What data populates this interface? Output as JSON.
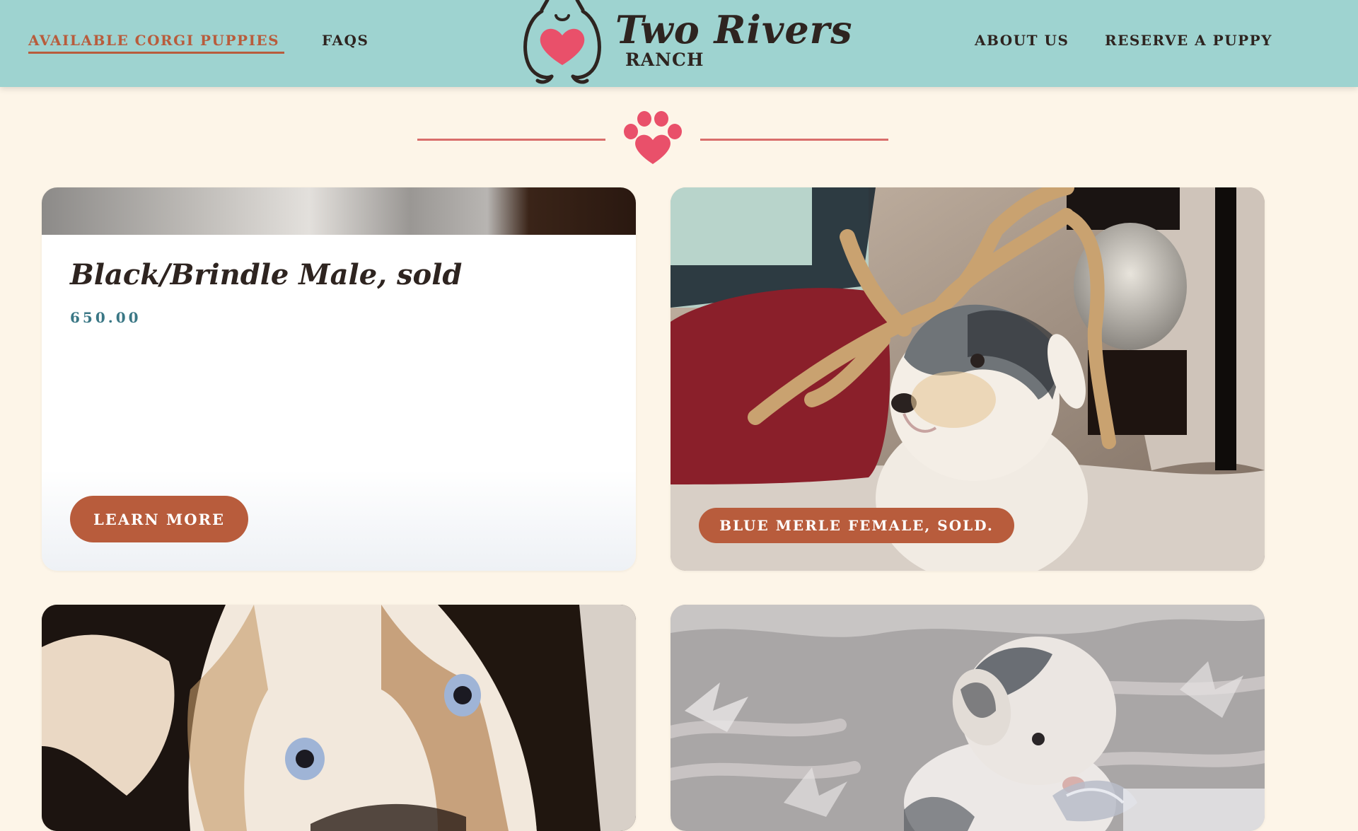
{
  "header": {
    "nav_left": [
      "AVAILABLE CORGI PUPPIES",
      "FAQS"
    ],
    "nav_right": [
      "ABOUT US",
      "RESERVE A PUPPY"
    ],
    "logo_title": "Two Rivers",
    "logo_subtitle": "RANCH"
  },
  "colors": {
    "header_bg": "#9ed3d0",
    "page_bg": "#fdf5e8",
    "accent": "#b85c3c",
    "paw": "#e9506a",
    "price": "#3a7785",
    "text_dark": "#2e2420"
  },
  "icons": [
    "corgi-heart-logo-icon",
    "paw-heart-icon"
  ],
  "cards": [
    {
      "title": "Black/Brindle Male, sold",
      "price": "650.00",
      "button_label": "LEARN MORE"
    },
    {
      "badge_label": "BLUE MERLE FEMALE, SOLD.",
      "image_alt": "Blue merle corgi puppy resting by antlers"
    },
    {
      "image_alt": "Close-up of tricolor puppy with blue eyes"
    },
    {
      "image_alt": "Blue merle puppy on grey blanket"
    }
  ]
}
